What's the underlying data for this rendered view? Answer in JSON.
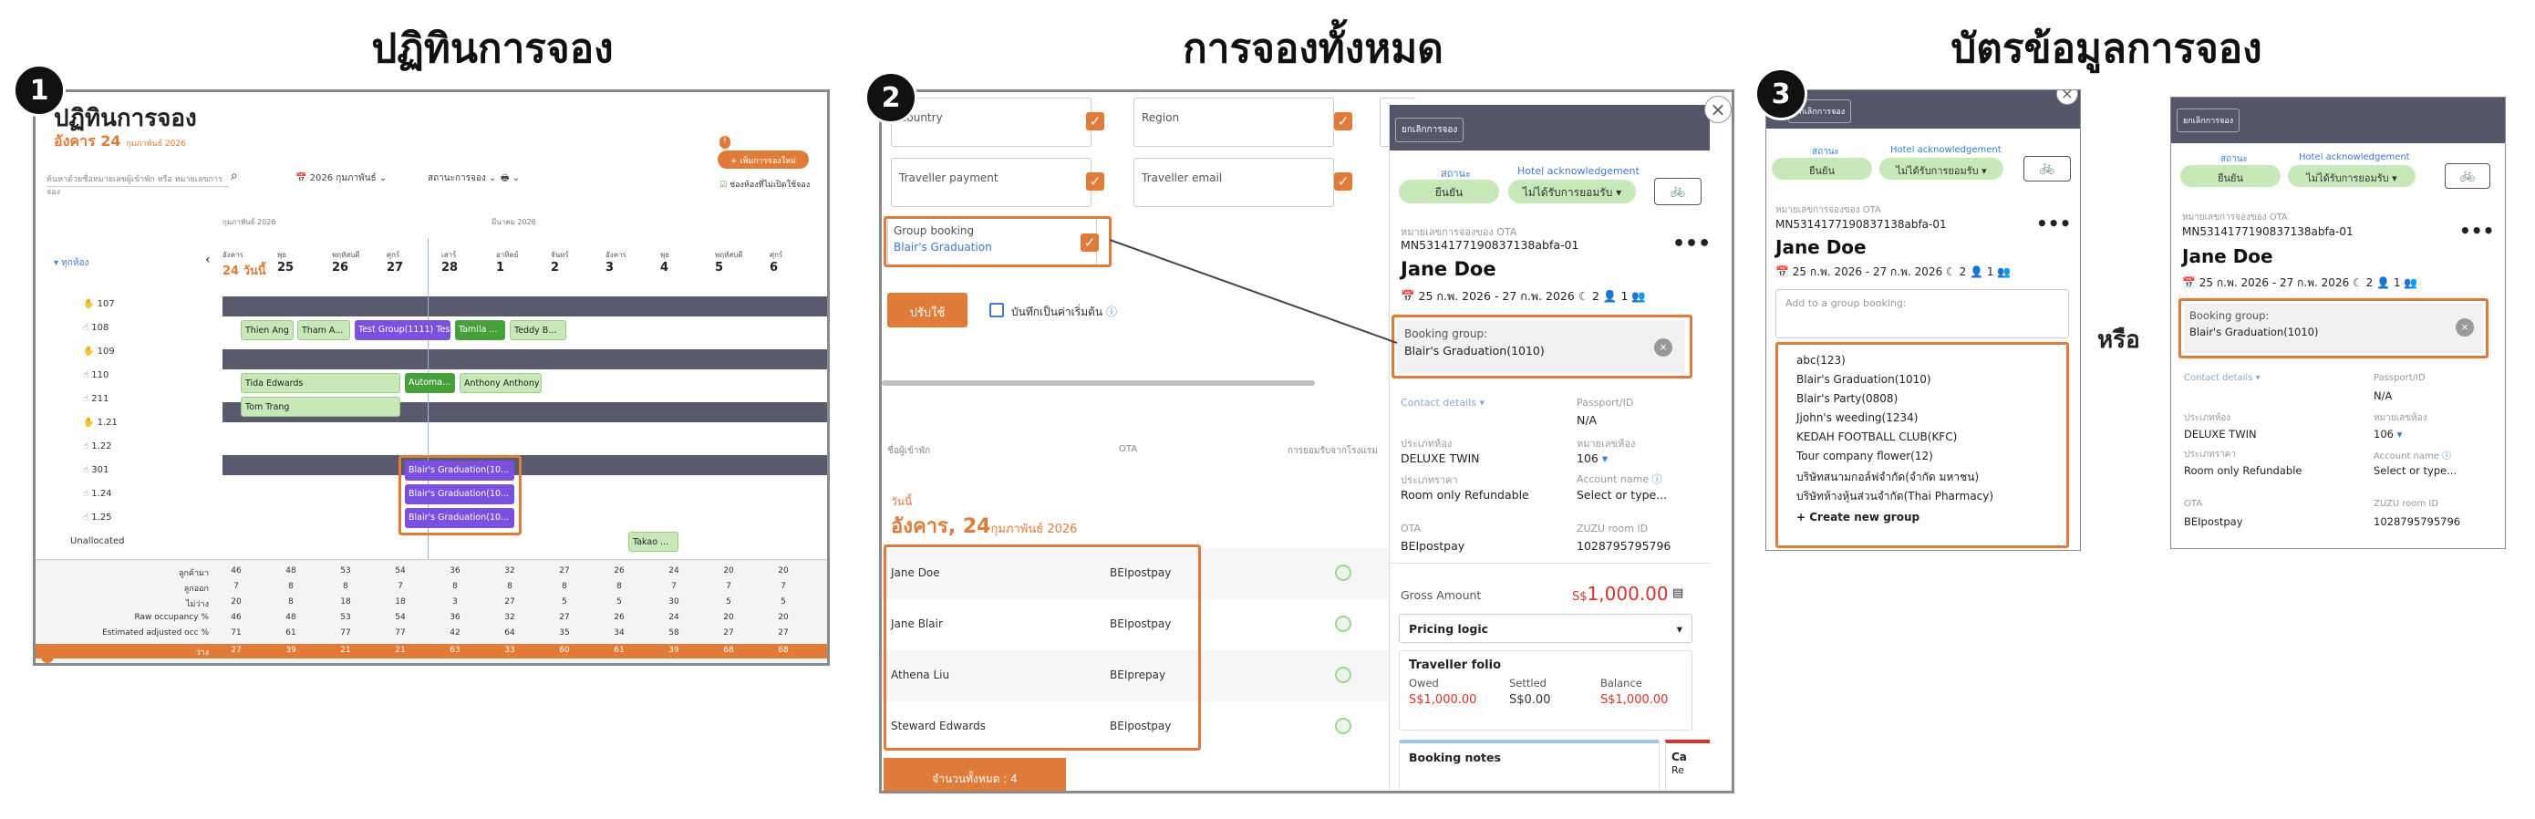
{
  "sections": {
    "s1_title": "ปฏิทินการจอง",
    "s2_title": "การจองทั้งหมด",
    "s3_title": "บัตรข้อมูลการจอง",
    "s1_badge": "1",
    "s2_badge": "2",
    "s3_badge": "3",
    "or_label": "หรือ"
  },
  "calendar": {
    "title": "ปฏิทินการจอง",
    "date_main": "อังคาร 24",
    "date_sub": "กุมภาพันธ์ 2026",
    "search_placeholder": "ค้นหาด้วยชื่อหมายเลขผู้เข้าพัก หรือ หมายเลขการจอง",
    "month_picker": "2026 กุมภาพันธ์",
    "status_filter": "สถานะการจอง",
    "new_booking": "+ เพิ่มการจองใหม่",
    "show_unassigned": "ช่องห้องที่ไม่เปิดใช้จอง",
    "room_filter": "ทุกห้อง",
    "month1": "กุมภาพันธ์ 2026",
    "month2": "มีนาคม 2026",
    "days": [
      {
        "dow": "อังคาร",
        "num": "24 วันนี้"
      },
      {
        "dow": "พุธ",
        "num": "25"
      },
      {
        "dow": "พฤหัสบดี",
        "num": "26"
      },
      {
        "dow": "ศุกร์",
        "num": "27"
      },
      {
        "dow": "เสาร์",
        "num": "28"
      },
      {
        "dow": "อาทิตย์",
        "num": "1"
      },
      {
        "dow": "จันทร์",
        "num": "2"
      },
      {
        "dow": "อังคาร",
        "num": "3"
      },
      {
        "dow": "พุธ",
        "num": "4"
      },
      {
        "dow": "พฤหัสบดี",
        "num": "5"
      },
      {
        "dow": "ศุกร์",
        "num": "6"
      }
    ],
    "rooms": [
      "107",
      "108",
      "109",
      "110",
      "211",
      "1.21",
      "1.22",
      "301",
      "1.24",
      "1.25",
      "Unallocated"
    ],
    "bookings": {
      "b1": "Thien Ang",
      "b2": "Tham A...",
      "b3": "Test Group(1111) Tes...",
      "b4": "Tamila ...",
      "b5": "Teddy B...",
      "b6": "Tida Edwards",
      "b7": "Automa...",
      "b8": "Anthony Anthony",
      "b9": "Tom Trang",
      "b10": "Blair's Graduation(10...",
      "b11": "Blair's Graduation(10...",
      "b12": "Blair's Graduation(10...",
      "b13": "Takao ..."
    },
    "stats": [
      {
        "label": "ลูกค้ามา",
        "values": [
          "46",
          "48",
          "53",
          "54",
          "36",
          "32",
          "27",
          "26",
          "24",
          "20",
          "20"
        ]
      },
      {
        "label": "ลูกออก",
        "values": [
          "7",
          "8",
          "8",
          "7",
          "8",
          "8",
          "8",
          "8",
          "7",
          "7",
          "7"
        ]
      },
      {
        "label": "ไม่ว่าง",
        "values": [
          "20",
          "8",
          "18",
          "18",
          "3",
          "27",
          "5",
          "5",
          "30",
          "5",
          "5"
        ]
      },
      {
        "label": "Raw occupancy %",
        "values": [
          "46",
          "48",
          "53",
          "54",
          "36",
          "32",
          "27",
          "26",
          "24",
          "20",
          "20"
        ]
      },
      {
        "label": "Estimated adjusted occ %",
        "values": [
          "71",
          "61",
          "77",
          "77",
          "42",
          "64",
          "35",
          "34",
          "58",
          "27",
          "27"
        ]
      },
      {
        "label": "ว่าง",
        "values": [
          "27",
          "39",
          "21",
          "21",
          "63",
          "33",
          "60",
          "61",
          "39",
          "68",
          "68"
        ]
      }
    ]
  },
  "all_bookings": {
    "f_country": "Country",
    "f_region": "Region",
    "f_traveller_payment": "Traveller payment",
    "f_traveller_email": "Traveller email",
    "f_group_booking": "Group booking",
    "f_group_value": "Blair's Graduation",
    "apply_button": "ปรับใช้",
    "save_default": "บันทึกเป็นค่าเริ่มต้น",
    "col_guest": "ชื่อผู้เข้าพัก",
    "col_ota": "OTA",
    "col_consent": "การยอมรับจากโรงแรม",
    "today_label": "วันนี้",
    "today_date": "อังคาร, 24",
    "today_month": "กุมภาพันธ์ 2026",
    "rows": [
      {
        "name": "Jane Doe",
        "ota": "BEIpostpay"
      },
      {
        "name": "Jane Blair",
        "ota": "BEIpostpay"
      },
      {
        "name": "Athena Liu",
        "ota": "BEIprepay"
      },
      {
        "name": "Steward Edwards",
        "ota": "BEIpostpay"
      }
    ],
    "total_label": "จำนวนทั้งหมด :",
    "total_value": "4"
  },
  "card": {
    "cancel_button": "ยกเลิกการจอง",
    "status_label": "สถานะ",
    "status_value": "ยืนยัน",
    "ack_label": "Hotel acknowledgement",
    "ack_value": "ไม่ได้รับการยอมรับ",
    "ota_number_label": "หมายเลขการจองของ OTA",
    "ota_number": "MN5314177190837138abfa-01",
    "guest_name": "Jane Doe",
    "dates": "25 ก.พ. 2026 - 27 ก.พ. 2026",
    "nights": "2",
    "guests": "1",
    "booking_group_label": "Booking group:",
    "booking_group_value": "Blair's Graduation(1010)",
    "contact_label": "Contact details",
    "passport_label": "Passport/ID",
    "passport_value": "N/A",
    "room_type_label": "ประเภทห้อง",
    "room_type_value": "DELUXE TWIN",
    "room_no_label": "หมายเลขห้อง",
    "room_no_value": "106",
    "rate_label": "ประเภทราคา",
    "rate_value": "Room only Refundable",
    "account_label": "Account name",
    "account_value": "Select or type...",
    "ota_label": "OTA",
    "ota_value": "BEIpostpay",
    "zuzu_label": "ZUZU room ID",
    "zuzu_value": "1028795795796",
    "gross_label": "Gross Amount",
    "gross_currency": "S$",
    "gross_value": "1,000.00",
    "pricing_logic": "Pricing logic",
    "folio_title": "Traveller folio",
    "owed_label": "Owed",
    "owed_value": "S$1,000.00",
    "settled_label": "Settled",
    "settled_value": "S$0.00",
    "balance_label": "Balance",
    "balance_value": "S$1,000.00",
    "notes_title": "Booking notes",
    "side_tab": "Ca",
    "side_tab2": "Re",
    "group_placeholder": "Add to a group booking:",
    "group_options": [
      "abc(123)",
      "Blair's Graduation(1010)",
      "Blair's Party(0808)",
      "Jjohn's weeding(1234)",
      "KEDAH FOOTBALL CLUB(KFC)",
      "Tour company flower(12)",
      "บริษัทสนามกอล์ฟจำกัด(จำกัด มหาชน)",
      "บริษัทห้างหุ้นส่วนจำกัด(Thai Pharmacy)"
    ],
    "create_group": "+  Create new group",
    "card3_cancel": "ยกเลิกการจอง"
  },
  "colors": {
    "accent": "#e07b39",
    "header": "#54566a",
    "confirm": "#c7e8b9",
    "link": "#3a7bd5",
    "price": "#d9322b"
  }
}
